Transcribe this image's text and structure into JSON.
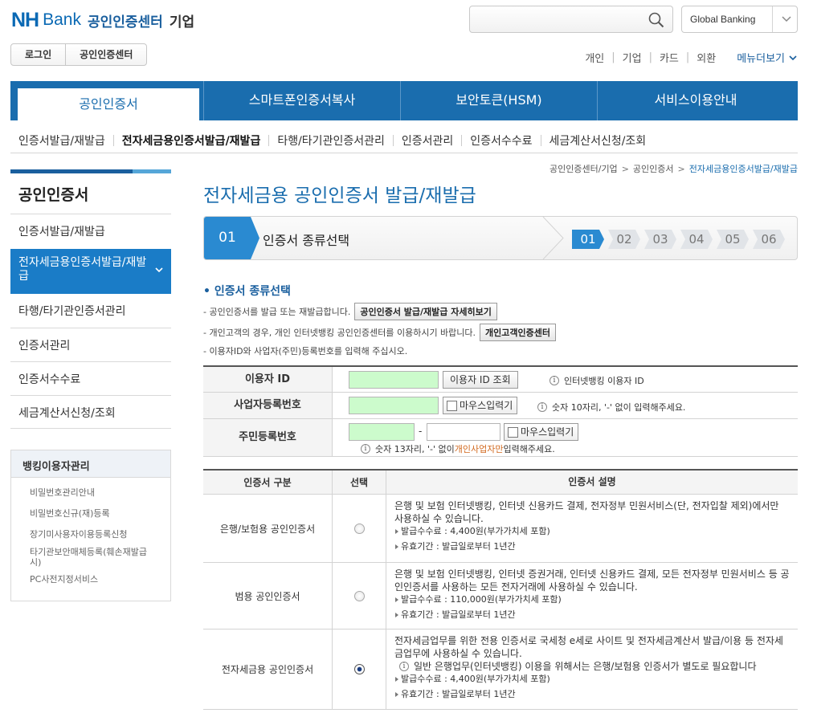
{
  "header": {
    "logo_nh": "NH",
    "logo_bank": "Bank",
    "logo_service": "공인인증센터",
    "logo_corp": "기업",
    "search_placeholder": "",
    "global_banking": "Global Banking",
    "tabs": [
      "로그인",
      "공인인증센터"
    ],
    "links": [
      "개인",
      "기업",
      "카드",
      "외환"
    ],
    "menu_more": "메뉴더보기"
  },
  "mainnav": [
    "공인인증서",
    "스마트폰인증서복사",
    "보안토큰(HSM)",
    "서비스이용안내"
  ],
  "subnav": [
    "인증서발급/재발급",
    "전자세금용인증서발급/재발급",
    "타행/타기관인증서관리",
    "인증서관리",
    "인증서수수료",
    "세금계산서신청/조회"
  ],
  "sidebar": {
    "title": "공인인증서",
    "items": [
      "인증서발급/재발급",
      "전자세금용인증서발급/재발급",
      "타행/타기관인증서관리",
      "인증서관리",
      "인증서수수료",
      "세금계산서신청/조회"
    ],
    "box_title": "뱅킹이용자관리",
    "box_items": [
      "비밀번호관리안내",
      "비밀번호신규(재)등록",
      "장기미사용자이용등록신청",
      "타기관보안매체등록(훼손재발급시)",
      "PC사전지정서비스"
    ]
  },
  "breadcrumb": [
    "공인인증센터/기업",
    "공인인증서",
    "전자세금용인증서발급/재발급"
  ],
  "page_title": "전자세금용 공인인증서 발급/재발급",
  "step": {
    "num": "01",
    "name": "인증서 종류선택",
    "steps": [
      "01",
      "02",
      "03",
      "04",
      "05",
      "06"
    ],
    "current": 1
  },
  "section_title": "인증서 종류선택",
  "notes": [
    {
      "text": "- 공인인증서를 발급 또는 재발급합니다.",
      "button": "공인인증서 발급/재발급 자세히보기"
    },
    {
      "text": "- 개인고객의 경우, 개인 인터넷뱅킹 공인인증센터를 이용하시기 바랍니다.",
      "button": "개인고객인증센터"
    },
    {
      "text": "- 이용자ID와 사업자(주민)등록번호를 입력해 주십시오.",
      "button": ""
    }
  ],
  "form": {
    "user_id_label": "이용자 ID",
    "user_id_btn": "이용자 ID 조회",
    "user_id_info": "인터넷뱅킹 이용자 ID",
    "biz_label": "사업자등록번호",
    "mouse_input": "마우스입력기",
    "biz_info": "숫자 10자리, '-' 없이 입력해주세요.",
    "resident_label": "주민등록번호",
    "dash": "-",
    "res_info_pre": "숫자 13자리, '-' 없이 ",
    "res_info_hl": "개인사업자만",
    "res_info_post": " 입력해주세요."
  },
  "cert_table": {
    "headers": [
      "인증서 구분",
      "선택",
      "인증서 설명"
    ],
    "rows": [
      {
        "name": "은행/보험용 공인인증서",
        "selected": false,
        "desc": "은행 및 보험 인터넷뱅킹, 인터넷 신용카드 결제, 전자정부 민원서비스(단, 전자입찰 제외)에서만 사용하실 수 있습니다.",
        "note": "",
        "fee": "발급수수료 : 4,400원(부가가치세 포함)",
        "validity": "유효기간 : 발급일로부터 1년간"
      },
      {
        "name": "범용 공인인증서",
        "selected": false,
        "desc": "은행 및 보험 인터넷뱅킹, 인터넷 증권거래, 인터넷 신용카드 결제, 모든 전자정부 민원서비스 등 공인인증서를 사용하는 모든 전자거래에 사용하실 수 있습니다.",
        "note": "",
        "fee": "발급수수료 : 110,000원(부가가치세 포함)",
        "validity": "유효기간 : 발급일로부터 1년간"
      },
      {
        "name": "전자세금용 공인인증서",
        "selected": true,
        "desc": "전자세금업무를 위한 전용 인증서로 국세청 e세로 사이트 및 전자세금계산서 발급/이용 등 전자세금업무에 사용하실 수 있습니다.",
        "note": "일반 은행업무(인터넷뱅킹) 이용을 위해서는 은행/보험용 인증서가 별도로 필요합니다",
        "fee": "발급수수료 : 4,400원(부가가치세 포함)",
        "validity": "유효기간 : 발급일로부터 1년간"
      }
    ]
  },
  "colors": {
    "brand": "#1a6dae",
    "active": "#2a8ad1",
    "input_green": "#ccfbcc",
    "highlight": "#d2691e"
  }
}
